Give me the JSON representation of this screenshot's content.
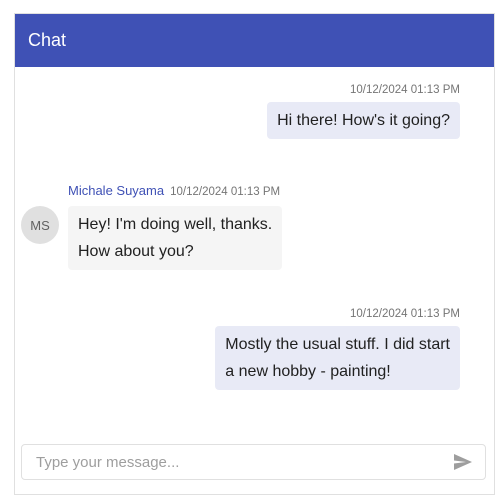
{
  "header": {
    "title": "Chat"
  },
  "messages": [
    {
      "direction": "outgoing",
      "timestamp": "10/12/2024 01:13 PM",
      "lines": [
        "Hi there! How's it going?"
      ]
    },
    {
      "direction": "incoming",
      "sender": "Michale Suyama",
      "avatar_initials": "MS",
      "timestamp": "10/12/2024 01:13 PM",
      "lines": [
        "Hey! I'm doing well, thanks.",
        "How about you?"
      ]
    },
    {
      "direction": "outgoing",
      "timestamp": "10/12/2024 01:13 PM",
      "lines": [
        "Mostly the usual stuff. I did start",
        "a new hobby - painting!"
      ]
    }
  ],
  "composer": {
    "placeholder": "Type your message...",
    "value": "",
    "send_icon": "send-icon"
  },
  "colors": {
    "header_bg": "#3f51b5",
    "outgoing_bubble": "#e8eaf6",
    "incoming_bubble": "#f5f5f5",
    "sender_name": "#3f51b5"
  }
}
